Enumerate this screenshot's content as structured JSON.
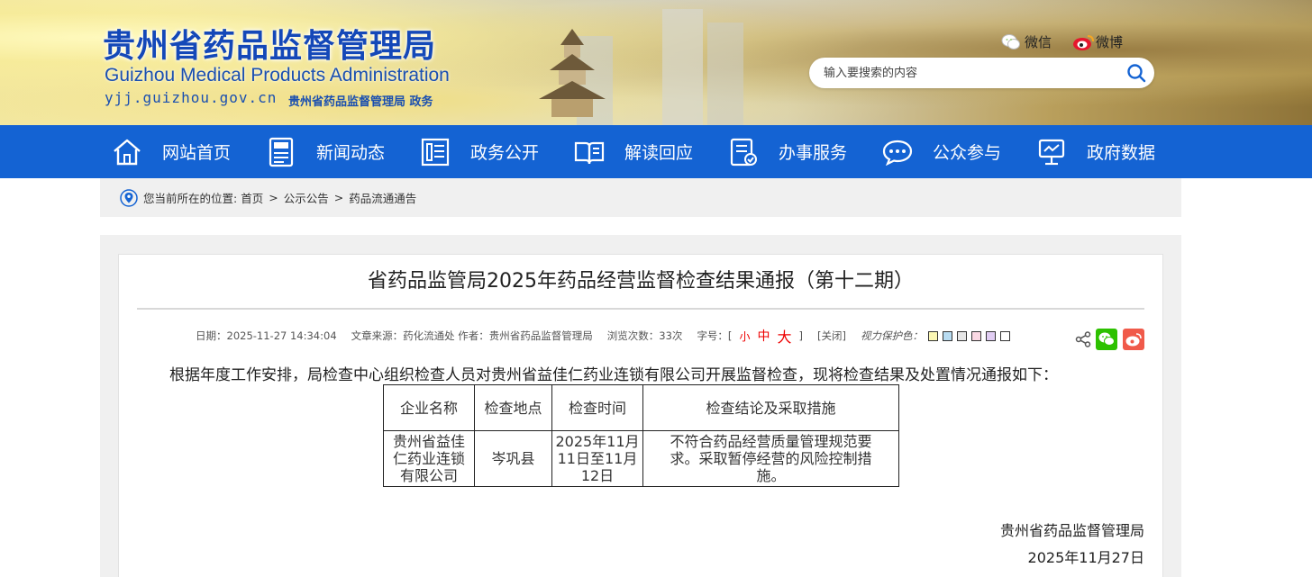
{
  "header": {
    "title": "贵州省药品监督管理局",
    "subtitle_en": "Guizhou Medical Products Administration",
    "domain": "yjj.guizhou.gov.cn",
    "tag": "贵州省药品监督管理局 政务",
    "wechat_label": "微信",
    "weibo_label": "微博",
    "search_placeholder": "输入要搜索的内容"
  },
  "nav": {
    "items": [
      {
        "label": "网站首页",
        "icon": "home-icon"
      },
      {
        "label": "新闻动态",
        "icon": "news-icon"
      },
      {
        "label": "政务公开",
        "icon": "document-list-icon"
      },
      {
        "label": "解读回应",
        "icon": "open-book-icon"
      },
      {
        "label": "办事服务",
        "icon": "form-icon"
      },
      {
        "label": "公众参与",
        "icon": "chat-bubble-icon"
      },
      {
        "label": "政府数据",
        "icon": "data-screen-icon"
      }
    ]
  },
  "breadcrumb": {
    "prefix": "您当前所在的位置:",
    "items": [
      "首页",
      "公示公告",
      "药品流通通告"
    ],
    "separator": ">"
  },
  "article": {
    "title": "省药品监管局2025年药品经营监督检查结果通报（第十二期）",
    "meta": {
      "date": "日期：2025-11-27 14:34:04",
      "source": "文章来源：药化流通处 作者：贵州省药品监督管理局",
      "views": "浏览次数：33次",
      "font_label": "字号：[",
      "font_small": "小",
      "font_mid": "中",
      "font_big": "大",
      "font_end": "]",
      "close": "[关闭]",
      "eye_label": "视力保护色：",
      "swatches": [
        "#fbf7b4",
        "#b8dcf2",
        "#e6e6e6",
        "#fbd9e4",
        "#e1cdf3",
        "#ffffff"
      ]
    },
    "intro": "根据年度工作安排，局检查中心组织检查人员对贵州省益佳仁药业连锁有限公司开展监督检查，现将检查结果及处置情况通报如下：",
    "table": {
      "headers": [
        "企业名称",
        "检查地点",
        "检查时间",
        "检查结论及采取措施"
      ],
      "rows": [
        [
          "贵州省益佳仁药业连锁有限公司",
          "岑巩县",
          "2025年11月11日至11月12日",
          "不符合药品经营质量管理规范要求。采取暂停经营的风险控制措施。"
        ]
      ]
    },
    "signature": "贵州省药品监督管理局",
    "sign_date": "2025年11月27日"
  },
  "colors": {
    "brand_blue": "#1463d3",
    "title_blue": "#1448b8",
    "wechat_green": "#2dc100",
    "weibo_red": "#f05a4a"
  }
}
